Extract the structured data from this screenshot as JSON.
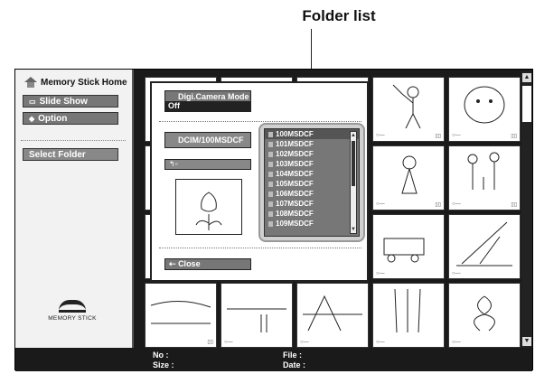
{
  "annotation": {
    "label": "Folder list"
  },
  "sidebar": {
    "home": "Memory Stick Home",
    "slideshow": "Slide Show",
    "option": "Option",
    "select_folder": "Select Folder",
    "logo_text": "MEMORY STICK"
  },
  "dialog": {
    "camera_mode_label": "Digi.Camera Mode",
    "camera_mode_value": "Off",
    "path": "DCIM/100MSDCF",
    "close": "Close",
    "folders": [
      "100MSDCF",
      "101MSDCF",
      "102MSDCF",
      "103MSDCF",
      "104MSDCF",
      "105MSDCF",
      "106MSDCF",
      "107MSDCF",
      "108MSDCF",
      "109MSDCF"
    ]
  },
  "info_bar": {
    "no": "No :",
    "size": "Size :",
    "file": "File :",
    "date": "Date :"
  },
  "colors": {
    "screen_bg": "#1a1a1a",
    "button": "#777777"
  }
}
